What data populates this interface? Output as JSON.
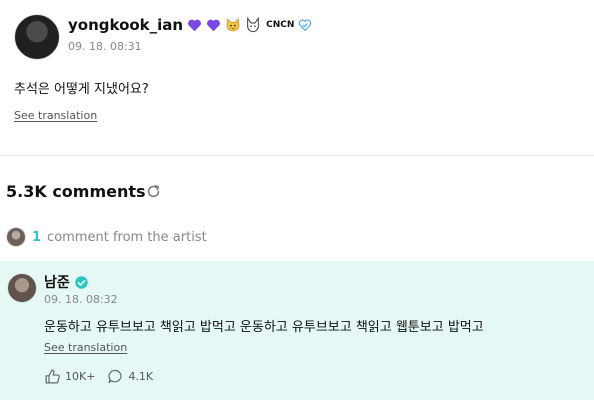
{
  "post": {
    "author_name": "yongkook_ian",
    "author_badge_text": "CNCN",
    "date": "09. 18. 08:31",
    "body": "추석은 어떻게 지냈어요?",
    "see_translation": "See translation"
  },
  "comments": {
    "title": "5.3K comments",
    "artist_count": "1",
    "artist_text": "comment from the artist"
  },
  "artist_comment": {
    "author_name": "남준",
    "date": "09. 18. 08:32",
    "body": "운동하고 유투브보고 책읽고 밥먹고 운동하고 유투브보고 책읽고 웹툰보고 밥먹고",
    "see_translation": "See translation",
    "likes": "10K+",
    "replies": "4.1K"
  },
  "colors": {
    "accent": "#2bc7c2",
    "highlight_bg": "#e6f8f6",
    "heart_purple": "#7b4ae2"
  },
  "icons": [
    "purple-heart-icon",
    "cat-emoji-icon",
    "fox-emoji-icon",
    "verified-badge-icon",
    "refresh-icon",
    "like-icon",
    "reply-icon"
  ]
}
